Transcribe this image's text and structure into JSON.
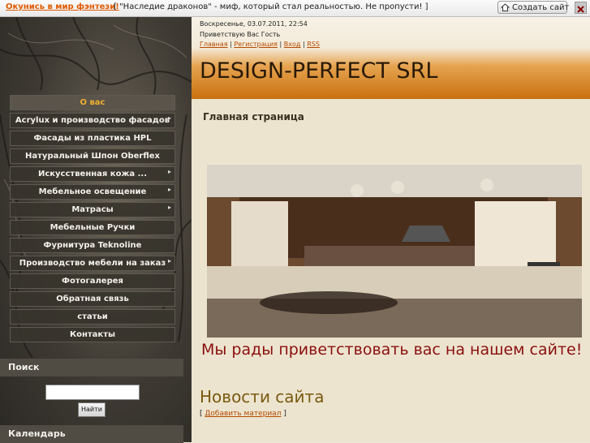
{
  "topbar": {
    "promo": "Окунись в мир фэнтези!",
    "message": "[ \"Наследие драконов\" - миф, который стал реальностью. Не пропусти! ]",
    "create_site": "Создать сайт"
  },
  "menu": {
    "items": [
      {
        "label": "О вас",
        "active": true,
        "arrow": false
      },
      {
        "label": "Acrylux и производство фасадов",
        "active": false,
        "arrow": true
      },
      {
        "label": "Фасады из пластика HPL",
        "active": false,
        "arrow": false
      },
      {
        "label": "Натуральный Шпон Oberflex",
        "active": false,
        "arrow": false
      },
      {
        "label": "Искусственная кожа ...",
        "active": false,
        "arrow": true
      },
      {
        "label": "Мебельное освещение",
        "active": false,
        "arrow": true
      },
      {
        "label": "Матрасы",
        "active": false,
        "arrow": true
      },
      {
        "label": "Мебельные Ручки",
        "active": false,
        "arrow": false
      },
      {
        "label": "Фурнитура Teknoline",
        "active": false,
        "arrow": false
      },
      {
        "label": "Производство мебели на заказ",
        "active": false,
        "arrow": true
      },
      {
        "label": "Фотогалерея",
        "active": false,
        "arrow": false
      },
      {
        "label": "Обратная связь",
        "active": false,
        "arrow": false
      },
      {
        "label": "статьи",
        "active": false,
        "arrow": false
      },
      {
        "label": "Контакты",
        "active": false,
        "arrow": false
      }
    ]
  },
  "search": {
    "title": "Поиск",
    "button": "Найти",
    "value": ""
  },
  "calendar": {
    "title": "Календарь"
  },
  "header": {
    "date": "Воскресенье, 03.07.2011, 22:54",
    "greeting": "Приветствую Вас Гость",
    "links": [
      "Главная",
      "Регистрация",
      "Вход",
      "RSS"
    ],
    "site_name": "DESIGN-PERFECT SRL"
  },
  "main": {
    "page_title": "Главная страница",
    "welcome": "Мы рады приветствовать вас на нашем сайте!",
    "news_title": "Новости сайта",
    "add_material": "Добавить материал"
  }
}
